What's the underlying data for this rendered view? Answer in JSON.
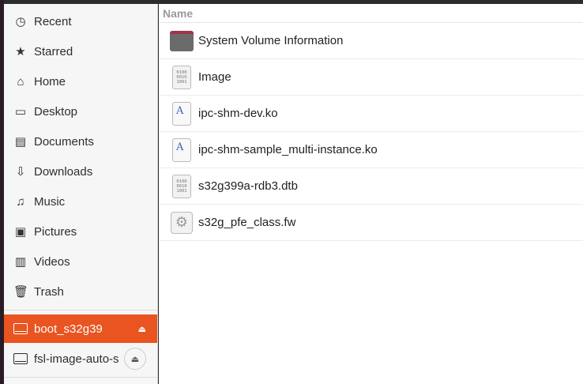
{
  "sidebar": {
    "places": [
      {
        "label": "Recent",
        "icon": "clock-icon"
      },
      {
        "label": "Starred",
        "icon": "star-icon"
      },
      {
        "label": "Home",
        "icon": "home-icon"
      },
      {
        "label": "Desktop",
        "icon": "desktop-icon"
      },
      {
        "label": "Documents",
        "icon": "document-icon"
      },
      {
        "label": "Downloads",
        "icon": "download-icon"
      },
      {
        "label": "Music",
        "icon": "music-icon"
      },
      {
        "label": "Pictures",
        "icon": "picture-icon"
      },
      {
        "label": "Videos",
        "icon": "video-icon"
      },
      {
        "label": "Trash",
        "icon": "trash-icon"
      }
    ],
    "devices": [
      {
        "label": "boot_s32g39",
        "active": true
      },
      {
        "label": "fsl-image-auto-s",
        "active": false
      }
    ],
    "accent": "#e95420"
  },
  "main": {
    "column_header": "Name",
    "files": [
      {
        "name": "System Volume Information",
        "type": "folder"
      },
      {
        "name": "Image",
        "type": "binary"
      },
      {
        "name": "ipc-shm-dev.ko",
        "type": "text"
      },
      {
        "name": "ipc-shm-sample_multi-instance.ko",
        "type": "text"
      },
      {
        "name": "s32g399a-rdb3.dtb",
        "type": "binary"
      },
      {
        "name": "s32g_pfe_class.fw",
        "type": "executable"
      }
    ],
    "binary_glyph": "0100\n0010\n1001",
    "text_glyph": "A"
  }
}
